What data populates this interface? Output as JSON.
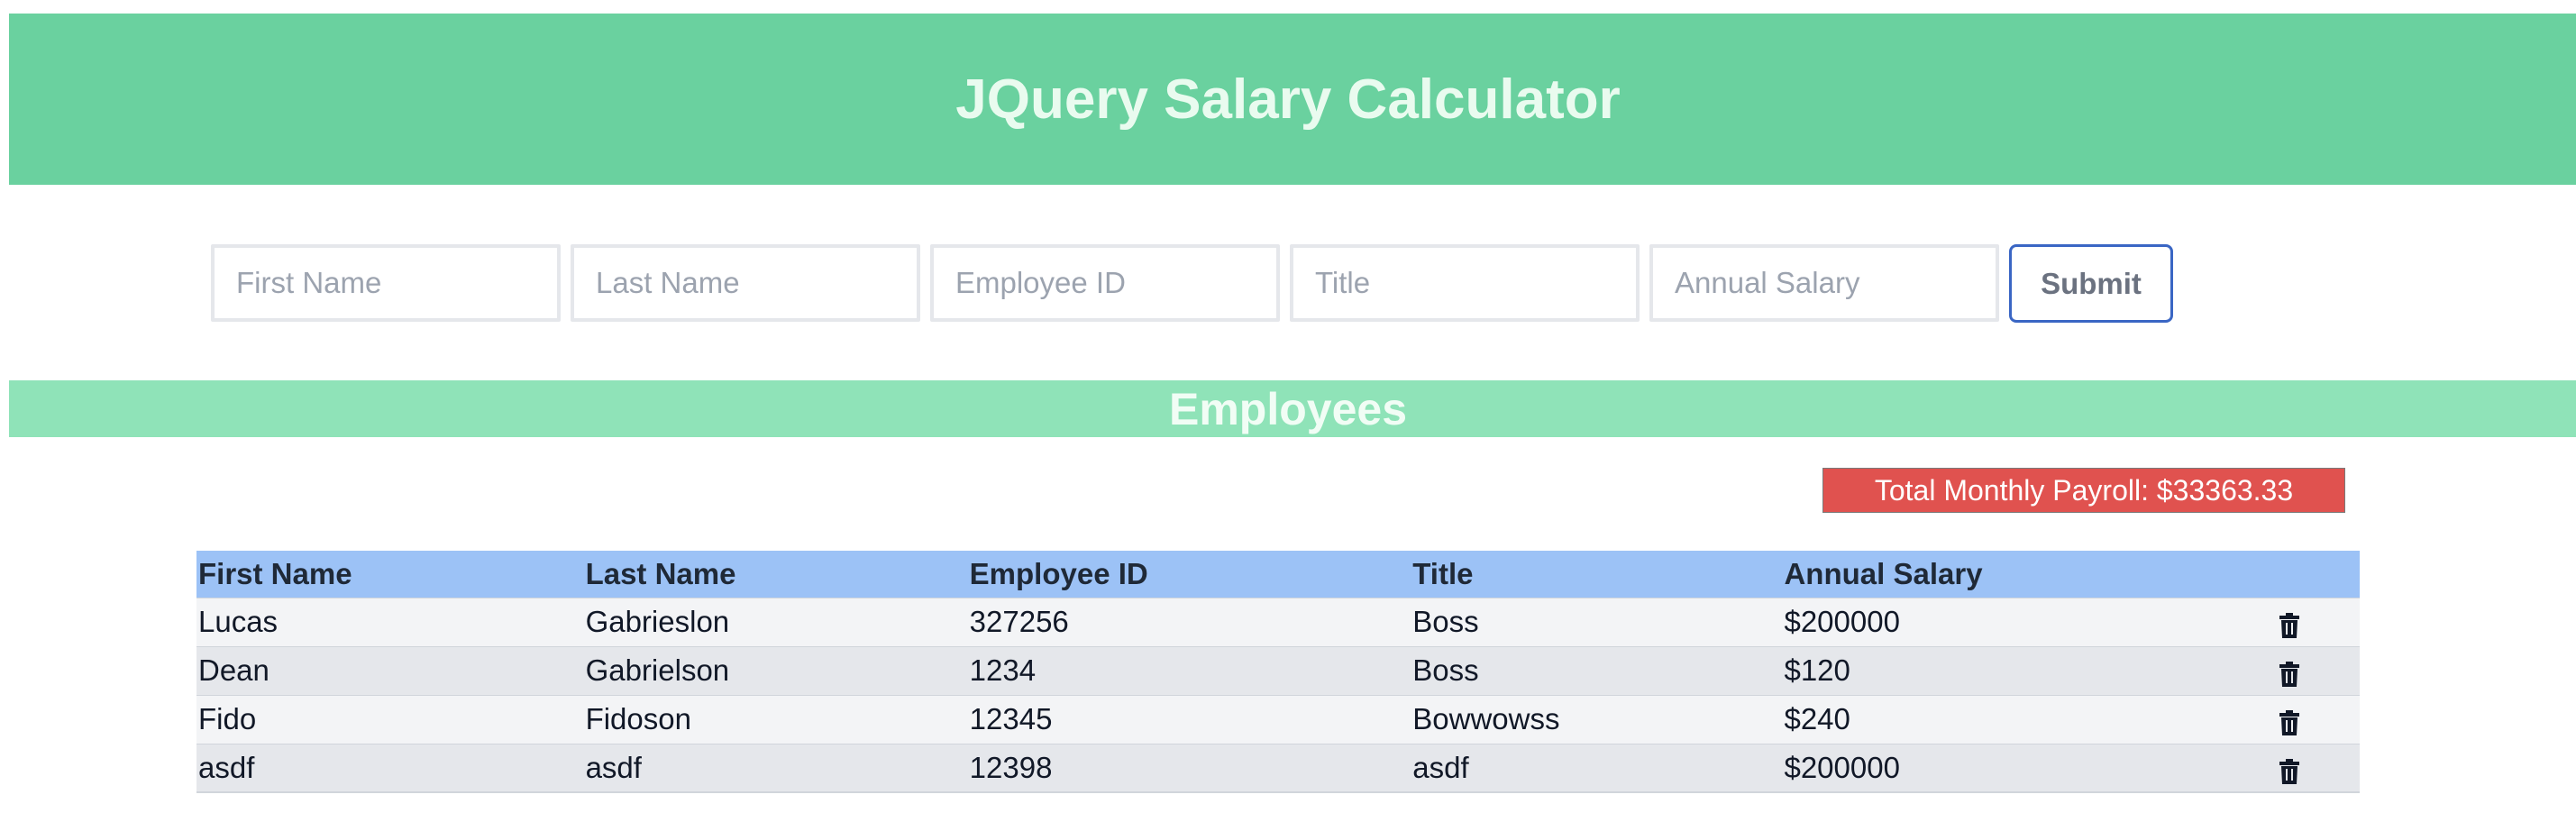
{
  "header": {
    "title": "JQuery Salary Calculator"
  },
  "form": {
    "first_name_placeholder": "First Name",
    "last_name_placeholder": "Last Name",
    "employee_id_placeholder": "Employee ID",
    "title_placeholder": "Title",
    "annual_salary_placeholder": "Annual Salary",
    "submit_label": "Submit"
  },
  "employees_section": {
    "heading": "Employees",
    "total_monthly_payroll": "Total Monthly Payroll: $33363.33"
  },
  "table": {
    "columns": [
      "First Name",
      "Last Name",
      "Employee ID",
      "Title",
      "Annual Salary"
    ],
    "rows": [
      {
        "first_name": "Lucas",
        "last_name": "Gabrieslon",
        "employee_id": "327256",
        "title": "Boss",
        "annual_salary": "$200000",
        "action_icon": "trash-icon"
      },
      {
        "first_name": "Dean",
        "last_name": "Gabrielson",
        "employee_id": "1234",
        "title": "Boss",
        "annual_salary": "$120",
        "action_icon": "trash-icon"
      },
      {
        "first_name": "Fido",
        "last_name": "Fidoson",
        "employee_id": "12345",
        "title": "Bowwowss",
        "annual_salary": "$240",
        "action_icon": "trash-icon"
      },
      {
        "first_name": "asdf",
        "last_name": "asdf",
        "employee_id": "12398",
        "title": "asdf",
        "annual_salary": "$200000",
        "action_icon": "trash-icon"
      }
    ]
  },
  "colors": {
    "header_bg": "#6ad19f",
    "employees_bar_bg": "#8fe3b8",
    "payroll_bg": "#e0524f",
    "table_header_bg": "#9cc2f6",
    "submit_border": "#3a66c4"
  }
}
